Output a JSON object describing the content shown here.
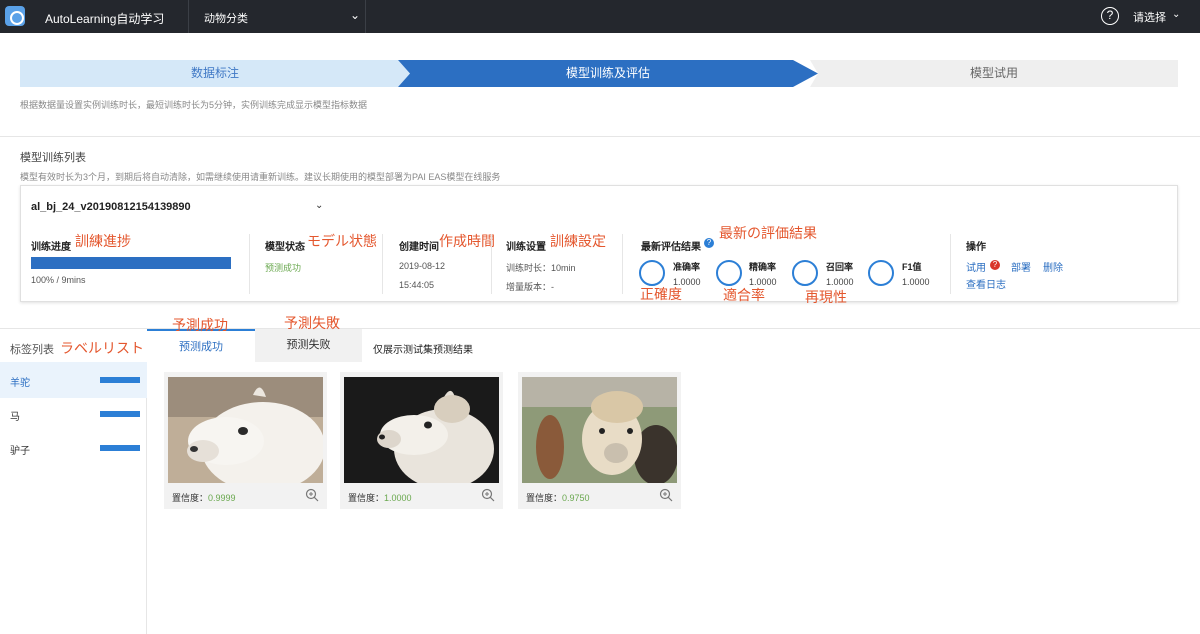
{
  "topbar": {
    "app_title": "AutoLearning自动学习",
    "project_select": "动物分类",
    "help_icon": "?",
    "user_select": "请选择"
  },
  "steps": [
    {
      "label": "数据标注",
      "state": "done"
    },
    {
      "label": "模型训练及评估",
      "state": "active"
    },
    {
      "label": "模型试用",
      "state": "pending"
    }
  ],
  "hint": "根据数据量设置实例训练时长，最短训练时长为5分钟，实例训练完成显示模型指标数据",
  "model_list": {
    "title": "模型训练列表",
    "subtitle": "模型有效时长为3个月，到期后将自动清除，如需继续使用请重新训练。建议长期使用的模型部署为PAI EAS模型在线服务"
  },
  "model": {
    "name": "al_bj_24_v20190812154139890",
    "progress": {
      "label": "训练进度",
      "value_text": "100% / 9mins",
      "fraction": 1.0
    },
    "status": {
      "label": "模型状态",
      "value": "预测成功"
    },
    "created": {
      "label": "创建时间",
      "date": "2019-08-12",
      "time": "15:44:05"
    },
    "settings": {
      "label": "训练设置",
      "duration": "训练时长：10min",
      "incremental": "增量版本：-"
    },
    "eval": {
      "label": "最新评估结果",
      "info_icon": "?",
      "metrics": [
        {
          "name": "准确率",
          "value": "1.0000"
        },
        {
          "name": "精确率",
          "value": "1.0000"
        },
        {
          "name": "召回率",
          "value": "1.0000"
        },
        {
          "name": "F1值",
          "value": "1.0000"
        }
      ]
    },
    "actions": {
      "label": "操作",
      "try": "试用",
      "try_badge": "?",
      "deploy": "部署",
      "delete": "删除",
      "logs": "查看日志"
    }
  },
  "annotations": {
    "progress": "訓練進捗",
    "status": "モデル状態",
    "created": "作成時間",
    "settings": "訓練設定",
    "eval": "最新の評価結果",
    "accuracy": "正確度",
    "precision": "適合率",
    "recall": "再現性",
    "tab_success": "予測成功",
    "tab_fail": "予測失敗",
    "labels": "ラベルリスト"
  },
  "labels_panel": {
    "title": "标签列表",
    "items": [
      {
        "label": "羊驼",
        "active": true
      },
      {
        "label": "马",
        "active": false
      },
      {
        "label": "驴子",
        "active": false
      }
    ]
  },
  "tabs": {
    "success": "预测成功",
    "fail": "预测失败",
    "note": "仅展示测试集预测结果"
  },
  "results": [
    {
      "conf_label": "置信度：",
      "conf_value": "0.9999"
    },
    {
      "conf_label": "置信度：",
      "conf_value": "1.0000"
    },
    {
      "conf_label": "置信度：",
      "conf_value": "0.9750"
    }
  ],
  "colors": {
    "accent": "#2c6fc2",
    "topbar": "#24272d",
    "success": "#6aa84f",
    "annotation": "#e4572e"
  }
}
